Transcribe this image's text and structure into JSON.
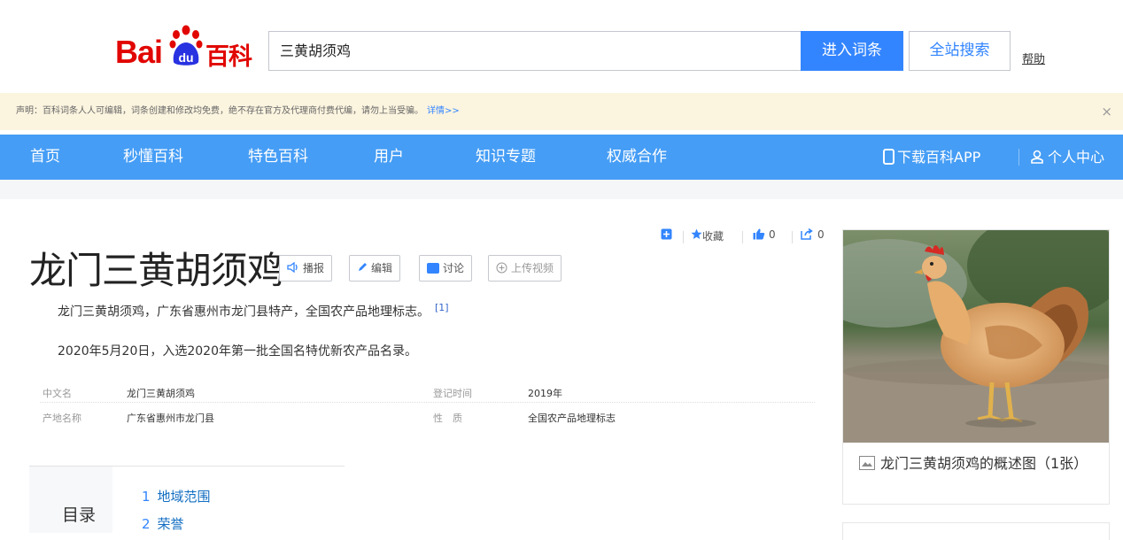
{
  "header": {
    "logo_text_bai": "Bai",
    "logo_text_du": "du",
    "logo_text_baike": "百科",
    "search_value": "三黄胡须鸡",
    "enter_button": "进入词条",
    "site_search_button": "全站搜索",
    "help_link": "帮助"
  },
  "notice": {
    "text": "声明：百科词条人人可编辑，词条创建和修改均免费，绝不存在官方及代理商付费代编，请勿上当受骗。",
    "more_link": "详情>>",
    "close": "×"
  },
  "nav": {
    "items": [
      "首页",
      "秒懂百科",
      "特色百科",
      "用户",
      "知识专题",
      "权威合作"
    ],
    "download_app": "下载百科APP",
    "user_center": "个人中心"
  },
  "entry": {
    "title": "龙门三黄胡须鸡",
    "chips": {
      "broadcast": "播报",
      "edit": "编辑",
      "discuss": "讨论",
      "upload_video": "上传视频"
    },
    "actions": {
      "collect": "收藏",
      "like_count": "0",
      "share_count": "0"
    },
    "summary": [
      {
        "text": "龙门三黄胡须鸡，广东省惠州市龙门县特产，全国农产品地理标志。",
        "ref": "[1]"
      },
      {
        "text": "2020年5月20日，入选2020年第一批全国名特优新农产品名录。"
      }
    ],
    "basic_info": [
      {
        "left_key": "中文名",
        "left_value": "龙门三黄胡须鸡",
        "right_key": "登记时间",
        "right_value": "2019年"
      },
      {
        "left_key": "产地名称",
        "left_value": "广东省惠州市龙门县",
        "right_key": "性　质",
        "right_value": "全国农产品地理标志"
      }
    ],
    "catalog": {
      "title": "目录",
      "items": [
        {
          "num": "1",
          "label": "地域范围"
        },
        {
          "num": "2",
          "label": "荣誉"
        }
      ]
    },
    "side_image": {
      "caption": "龙门三黄胡须鸡的概述图（1张）"
    }
  },
  "colors": {
    "brand_red": "#e10601",
    "nav_blue": "#459df5",
    "button_blue": "#3385ff",
    "notice_bg": "#fbf4df"
  }
}
